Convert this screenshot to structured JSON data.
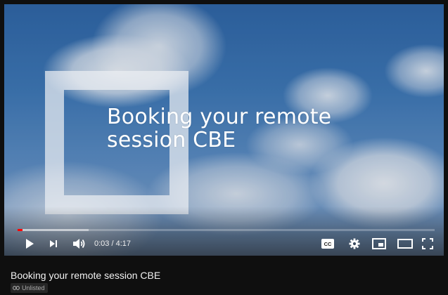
{
  "video": {
    "overlay_title": "Booking your remote session CBE",
    "progress": {
      "played_fraction": 0.012,
      "buffered_fraction": 0.17
    },
    "time_display": "0:03 / 4:17"
  },
  "controls": {
    "play_icon": "play-icon",
    "next_icon": "next-icon",
    "volume_icon": "volume-icon",
    "cc_icon": "cc-icon",
    "settings_icon": "gear-icon",
    "miniplayer_icon": "miniplayer-icon",
    "theater_icon": "theater-mode-icon",
    "fullscreen_icon": "fullscreen-icon"
  },
  "info": {
    "title": "Booking your remote session CBE",
    "visibility_badge": "Unlisted",
    "visibility_icon": "link-icon"
  },
  "colors": {
    "page_background": "#0f0f0f",
    "progress_played": "#ff0000",
    "badge_background": "#272727",
    "badge_text": "#aaaaaa"
  }
}
